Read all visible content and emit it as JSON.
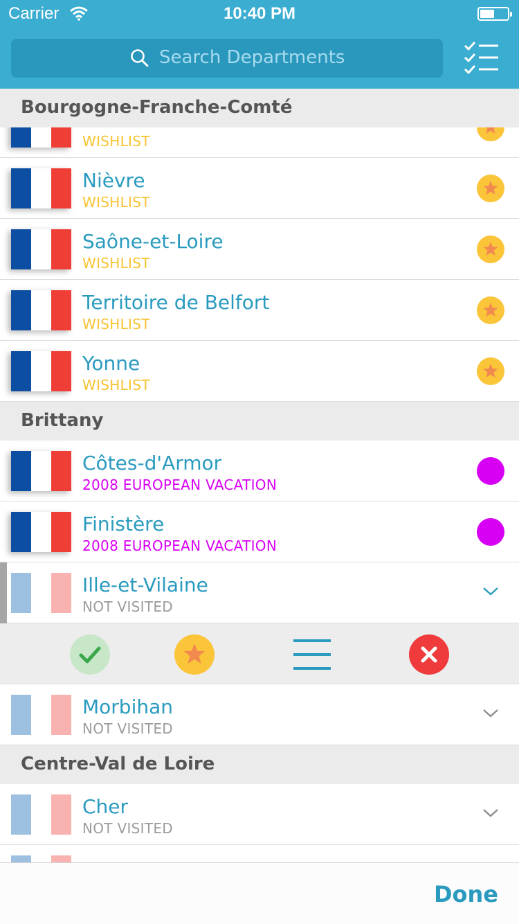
{
  "status_bar": {
    "carrier": "Carrier",
    "time": "10:40 PM"
  },
  "search": {
    "placeholder": "Search Departments"
  },
  "colors": {
    "accent": "#3aadd1",
    "wishlist": "#f7c330",
    "vacation": "#d800f4",
    "not_visited": "#9b9b9b",
    "name": "#2a9bbf"
  },
  "sections": [
    {
      "title": "Bourgogne-Franche-Comté",
      "rows": [
        {
          "name": "",
          "status": "WISHLIST",
          "indicator": "star-icon"
        },
        {
          "name": "Nièvre",
          "status": "WISHLIST",
          "indicator": "star-icon"
        },
        {
          "name": "Saône-et-Loire",
          "status": "WISHLIST",
          "indicator": "star-icon"
        },
        {
          "name": "Territoire de Belfort",
          "status": "WISHLIST",
          "indicator": "star-icon"
        },
        {
          "name": "Yonne",
          "status": "WISHLIST",
          "indicator": "star-icon"
        }
      ]
    },
    {
      "title": "Brittany",
      "rows": [
        {
          "name": "Côtes-d'Armor",
          "status": "2008 EUROPEAN VACATION",
          "indicator": "color-dot"
        },
        {
          "name": "Finistère",
          "status": "2008 EUROPEAN VACATION",
          "indicator": "color-dot"
        },
        {
          "name": "Ille-et-Vilaine",
          "status": "NOT VISITED",
          "indicator": "chevron-down-icon",
          "expanded": true
        },
        {
          "name": "Morbihan",
          "status": "NOT VISITED",
          "indicator": "chevron-down-icon"
        }
      ]
    },
    {
      "title": "Centre-Val de Loire",
      "rows": [
        {
          "name": "Cher",
          "status": "NOT VISITED",
          "indicator": "chevron-down-icon"
        },
        {
          "name": "",
          "status": "",
          "indicator": "chevron-down-icon"
        }
      ]
    }
  ],
  "actions": [
    {
      "icon": "checkmark-icon"
    },
    {
      "icon": "star-icon"
    },
    {
      "icon": "list-icon"
    },
    {
      "icon": "close-icon"
    }
  ],
  "footer": {
    "done_label": "Done"
  }
}
